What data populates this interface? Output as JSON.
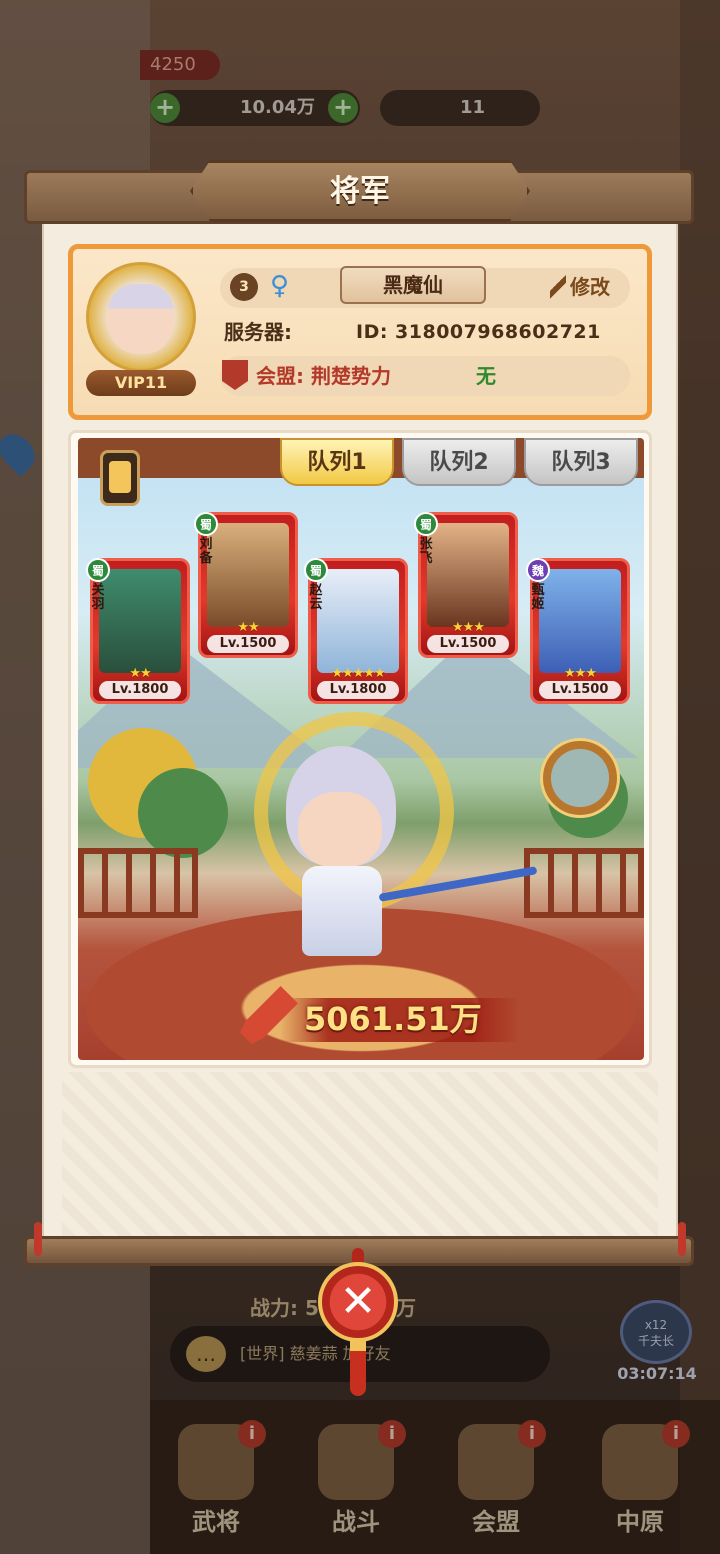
{
  "background": {
    "power_pill": "4250",
    "resources": {
      "gold_amount": "10.04万",
      "ticket_amount": "11"
    },
    "power_line": "战力: 5061.51万",
    "chat": {
      "channel": "[世界]",
      "message": "慈姜蒜 加好友"
    },
    "timer": {
      "multiplier": "x12",
      "label": "千夫长",
      "remaining": "03:07:14"
    },
    "nav": [
      {
        "label": "武将",
        "badge": "i"
      },
      {
        "label": "战斗",
        "badge": "i"
      },
      {
        "label": "会盟",
        "badge": "i"
      },
      {
        "label": "中原",
        "badge": "i"
      }
    ]
  },
  "modal": {
    "title": "将军",
    "profile": {
      "vip": "VIP11",
      "level": "3",
      "gender_icon": "female-icon",
      "name": "黑魔仙",
      "edit_label": "修改",
      "server_label": "服务器:",
      "id_text": "ID: 318007968602721",
      "alliance_text": "会盟: 荆楚势力",
      "alliance_status": "无"
    },
    "tabs": [
      {
        "label": "队列1",
        "active": true
      },
      {
        "label": "队列2",
        "active": false
      },
      {
        "label": "队列3",
        "active": false
      }
    ],
    "heroes": [
      {
        "name": "关羽",
        "faction": "蜀",
        "stars": "★★",
        "level": "Lv.1800"
      },
      {
        "name": "刘备",
        "faction": "蜀",
        "stars": "★★",
        "level": "Lv.1500"
      },
      {
        "name": "赵云",
        "faction": "蜀",
        "stars": "★★★★★",
        "level": "Lv.1800"
      },
      {
        "name": "张飞",
        "faction": "蜀",
        "stars": "★★★",
        "level": "Lv.1500"
      },
      {
        "name": "甄姬",
        "faction": "魏",
        "stars": "★★★",
        "level": "Lv.1500"
      }
    ],
    "combat_power": "5061.51万",
    "close_icon": "close-icon",
    "colors": {
      "accent_orange": "#ef9a3a",
      "power_gold": "#ffe083",
      "alliance_red": "#b3392a",
      "status_green": "#2f8a2e"
    }
  }
}
